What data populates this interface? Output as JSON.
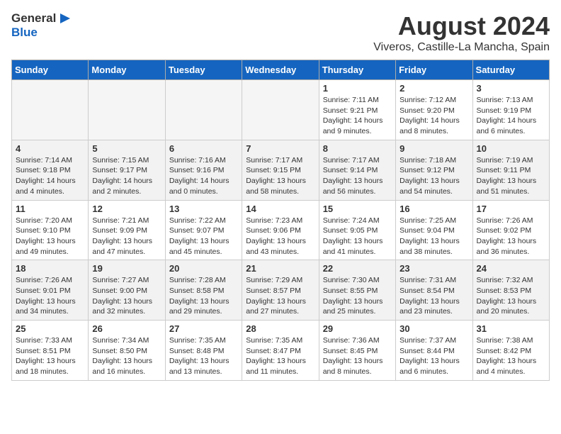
{
  "logo": {
    "general": "General",
    "blue": "Blue"
  },
  "title": {
    "month": "August 2024",
    "location": "Viveros, Castille-La Mancha, Spain"
  },
  "headers": [
    "Sunday",
    "Monday",
    "Tuesday",
    "Wednesday",
    "Thursday",
    "Friday",
    "Saturday"
  ],
  "weeks": [
    [
      {
        "day": "",
        "empty": true
      },
      {
        "day": "",
        "empty": true
      },
      {
        "day": "",
        "empty": true
      },
      {
        "day": "",
        "empty": true
      },
      {
        "day": "1",
        "sunrise": "7:11 AM",
        "sunset": "9:21 PM",
        "daylight": "14 hours and 9 minutes."
      },
      {
        "day": "2",
        "sunrise": "7:12 AM",
        "sunset": "9:20 PM",
        "daylight": "14 hours and 8 minutes."
      },
      {
        "day": "3",
        "sunrise": "7:13 AM",
        "sunset": "9:19 PM",
        "daylight": "14 hours and 6 minutes."
      }
    ],
    [
      {
        "day": "4",
        "sunrise": "7:14 AM",
        "sunset": "9:18 PM",
        "daylight": "14 hours and 4 minutes."
      },
      {
        "day": "5",
        "sunrise": "7:15 AM",
        "sunset": "9:17 PM",
        "daylight": "14 hours and 2 minutes."
      },
      {
        "day": "6",
        "sunrise": "7:16 AM",
        "sunset": "9:16 PM",
        "daylight": "14 hours and 0 minutes."
      },
      {
        "day": "7",
        "sunrise": "7:17 AM",
        "sunset": "9:15 PM",
        "daylight": "13 hours and 58 minutes."
      },
      {
        "day": "8",
        "sunrise": "7:17 AM",
        "sunset": "9:14 PM",
        "daylight": "13 hours and 56 minutes."
      },
      {
        "day": "9",
        "sunrise": "7:18 AM",
        "sunset": "9:12 PM",
        "daylight": "13 hours and 54 minutes."
      },
      {
        "day": "10",
        "sunrise": "7:19 AM",
        "sunset": "9:11 PM",
        "daylight": "13 hours and 51 minutes."
      }
    ],
    [
      {
        "day": "11",
        "sunrise": "7:20 AM",
        "sunset": "9:10 PM",
        "daylight": "13 hours and 49 minutes."
      },
      {
        "day": "12",
        "sunrise": "7:21 AM",
        "sunset": "9:09 PM",
        "daylight": "13 hours and 47 minutes."
      },
      {
        "day": "13",
        "sunrise": "7:22 AM",
        "sunset": "9:07 PM",
        "daylight": "13 hours and 45 minutes."
      },
      {
        "day": "14",
        "sunrise": "7:23 AM",
        "sunset": "9:06 PM",
        "daylight": "13 hours and 43 minutes."
      },
      {
        "day": "15",
        "sunrise": "7:24 AM",
        "sunset": "9:05 PM",
        "daylight": "13 hours and 41 minutes."
      },
      {
        "day": "16",
        "sunrise": "7:25 AM",
        "sunset": "9:04 PM",
        "daylight": "13 hours and 38 minutes."
      },
      {
        "day": "17",
        "sunrise": "7:26 AM",
        "sunset": "9:02 PM",
        "daylight": "13 hours and 36 minutes."
      }
    ],
    [
      {
        "day": "18",
        "sunrise": "7:26 AM",
        "sunset": "9:01 PM",
        "daylight": "13 hours and 34 minutes."
      },
      {
        "day": "19",
        "sunrise": "7:27 AM",
        "sunset": "9:00 PM",
        "daylight": "13 hours and 32 minutes."
      },
      {
        "day": "20",
        "sunrise": "7:28 AM",
        "sunset": "8:58 PM",
        "daylight": "13 hours and 29 minutes."
      },
      {
        "day": "21",
        "sunrise": "7:29 AM",
        "sunset": "8:57 PM",
        "daylight": "13 hours and 27 minutes."
      },
      {
        "day": "22",
        "sunrise": "7:30 AM",
        "sunset": "8:55 PM",
        "daylight": "13 hours and 25 minutes."
      },
      {
        "day": "23",
        "sunrise": "7:31 AM",
        "sunset": "8:54 PM",
        "daylight": "13 hours and 23 minutes."
      },
      {
        "day": "24",
        "sunrise": "7:32 AM",
        "sunset": "8:53 PM",
        "daylight": "13 hours and 20 minutes."
      }
    ],
    [
      {
        "day": "25",
        "sunrise": "7:33 AM",
        "sunset": "8:51 PM",
        "daylight": "13 hours and 18 minutes."
      },
      {
        "day": "26",
        "sunrise": "7:34 AM",
        "sunset": "8:50 PM",
        "daylight": "13 hours and 16 minutes."
      },
      {
        "day": "27",
        "sunrise": "7:35 AM",
        "sunset": "8:48 PM",
        "daylight": "13 hours and 13 minutes."
      },
      {
        "day": "28",
        "sunrise": "7:35 AM",
        "sunset": "8:47 PM",
        "daylight": "13 hours and 11 minutes."
      },
      {
        "day": "29",
        "sunrise": "7:36 AM",
        "sunset": "8:45 PM",
        "daylight": "13 hours and 8 minutes."
      },
      {
        "day": "30",
        "sunrise": "7:37 AM",
        "sunset": "8:44 PM",
        "daylight": "13 hours and 6 minutes."
      },
      {
        "day": "31",
        "sunrise": "7:38 AM",
        "sunset": "8:42 PM",
        "daylight": "13 hours and 4 minutes."
      }
    ]
  ]
}
